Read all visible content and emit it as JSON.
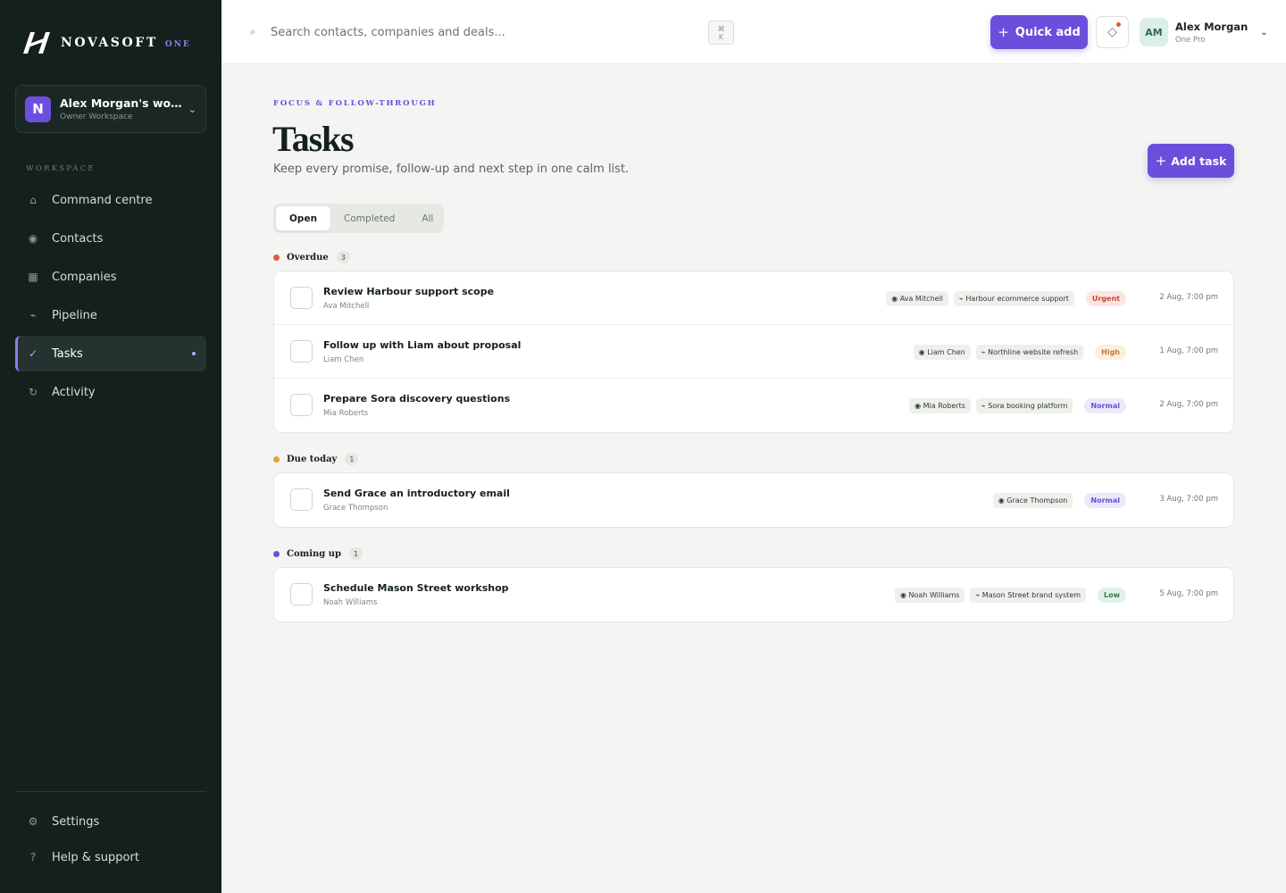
{
  "brand": {
    "name": "NOVASOFT",
    "suffix": "ONE"
  },
  "workspace": {
    "initial": "N",
    "name": "Alex Morgan's work...",
    "role": "Owner Workspace"
  },
  "sidebar": {
    "section_label": "WORKSPACE",
    "items": [
      {
        "label": "Command centre",
        "icon": "home-icon",
        "active": false
      },
      {
        "label": "Contacts",
        "icon": "contacts-icon",
        "active": false
      },
      {
        "label": "Companies",
        "icon": "companies-icon",
        "active": false
      },
      {
        "label": "Pipeline",
        "icon": "pipeline-icon",
        "active": false
      },
      {
        "label": "Tasks",
        "icon": "check-icon",
        "active": true
      },
      {
        "label": "Activity",
        "icon": "activity-icon",
        "active": false
      }
    ],
    "footer": [
      {
        "label": "Settings",
        "icon": "gear-icon"
      },
      {
        "label": "Help & support",
        "icon": "help-icon"
      }
    ]
  },
  "topbar": {
    "search_placeholder": "Search contacts, companies and deals...",
    "shortcut_line1": "⌘",
    "shortcut_line2": "K",
    "quick_add_label": "Quick add",
    "user": {
      "initials": "AM",
      "name": "Alex Morgan",
      "plan": "One Pro"
    }
  },
  "page": {
    "eyebrow": "FOCUS & FOLLOW-THROUGH",
    "title": "Tasks",
    "subtitle": "Keep every promise, follow-up and next step in one calm list.",
    "add_task_label": "Add task",
    "tabs": [
      {
        "label": "Open",
        "active": true
      },
      {
        "label": "Completed",
        "active": false
      },
      {
        "label": "All",
        "active": false
      }
    ]
  },
  "colors": {
    "accent": "#6a4fdc",
    "overdue": "#e4573f",
    "due_today": "#e7a23a",
    "coming_up": "#6a4fdc"
  },
  "groups": [
    {
      "label": "Overdue",
      "count": "3",
      "color": "#e4573f",
      "tasks": [
        {
          "title": "Review Harbour support scope",
          "who": "Ava Mitchell",
          "contact": "Ava Mitchell",
          "deal": "Harbour ecommerce support",
          "priority": "Urgent",
          "priority_kind": "urgent",
          "due": "2 Aug, 7:00 pm"
        },
        {
          "title": "Follow up with Liam about proposal",
          "who": "Liam Chen",
          "contact": "Liam Chen",
          "deal": "Northline website refresh",
          "priority": "High",
          "priority_kind": "high",
          "due": "1 Aug, 7:00 pm"
        },
        {
          "title": "Prepare Sora discovery questions",
          "who": "Mia Roberts",
          "contact": "Mia Roberts",
          "deal": "Sora booking platform",
          "priority": "Normal",
          "priority_kind": "normal",
          "due": "2 Aug, 7:00 pm"
        }
      ]
    },
    {
      "label": "Due today",
      "count": "1",
      "color": "#e7a23a",
      "tasks": [
        {
          "title": "Send Grace an introductory email",
          "who": "Grace Thompson",
          "contact": "Grace Thompson",
          "deal": "",
          "priority": "Normal",
          "priority_kind": "normal",
          "due": "3 Aug, 7:00 pm"
        }
      ]
    },
    {
      "label": "Coming up",
      "count": "1",
      "color": "#6a4fdc",
      "tasks": [
        {
          "title": "Schedule Mason Street workshop",
          "who": "Noah Williams",
          "contact": "Noah Williams",
          "deal": "Mason Street brand system",
          "priority": "Low",
          "priority_kind": "low",
          "due": "5 Aug, 7:00 pm"
        }
      ]
    }
  ]
}
